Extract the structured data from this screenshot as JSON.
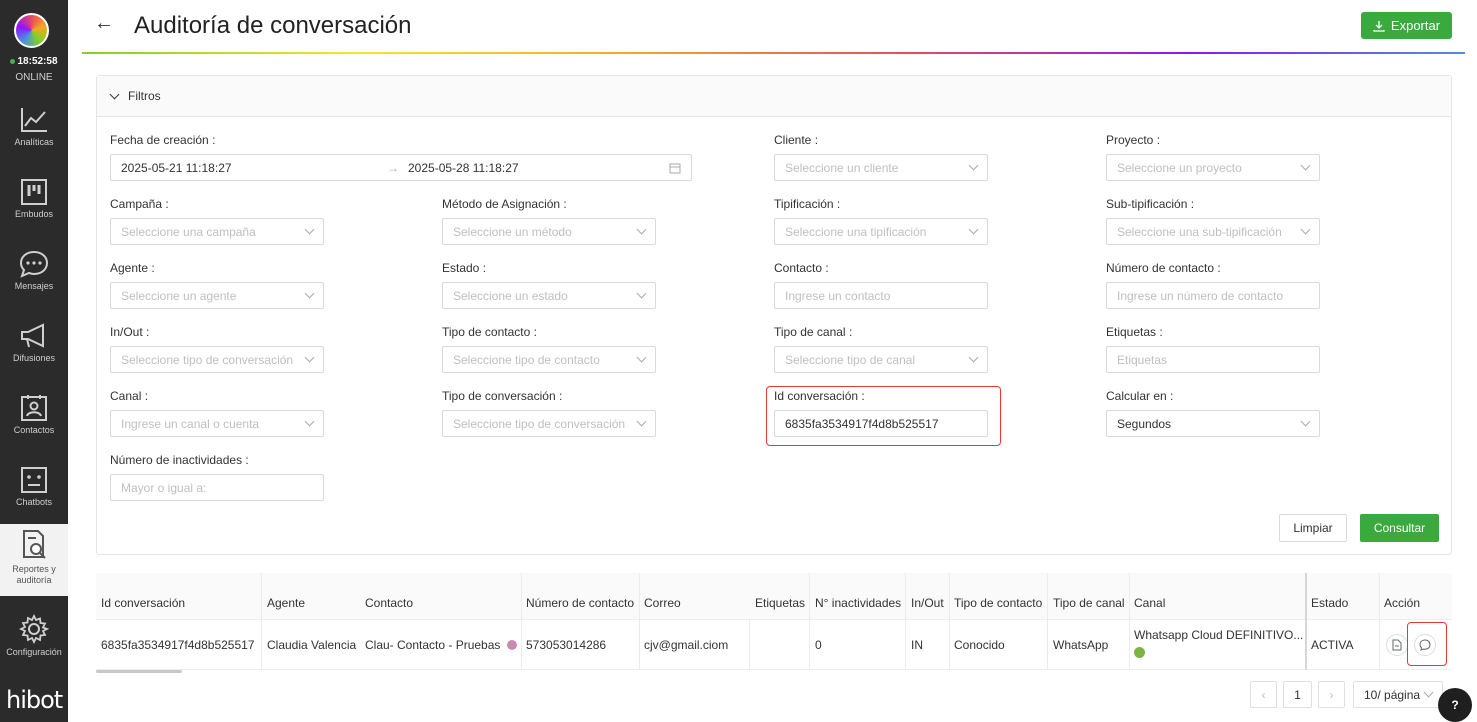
{
  "sidebar": {
    "time": "18:52:58",
    "status": "ONLINE",
    "items": [
      {
        "label": "Analíticas",
        "icon": "chart-line-icon"
      },
      {
        "label": "Embudos",
        "icon": "kanban-icon"
      },
      {
        "label": "Mensajes",
        "icon": "chat-bubble-icon"
      },
      {
        "label": "Difusiones",
        "icon": "megaphone-icon"
      },
      {
        "label": "Contactos",
        "icon": "contact-card-icon"
      },
      {
        "label": "Chatbots",
        "icon": "robot-icon"
      },
      {
        "label": "Reportes y auditoría",
        "icon": "report-search-icon"
      },
      {
        "label": "Configuración",
        "icon": "gear-icon"
      }
    ],
    "brand": "hibot"
  },
  "header": {
    "title": "Auditoría de conversación",
    "export_label": "Exportar"
  },
  "filters": {
    "section_label": "Filtros",
    "fecha_label": "Fecha de creación",
    "fecha_start": "2025-05-21 11:18:27",
    "fecha_end": "2025-05-28 11:18:27",
    "cliente_label": "Cliente",
    "cliente_ph": "Seleccione un cliente",
    "proyecto_label": "Proyecto",
    "proyecto_ph": "Seleccione un proyecto",
    "campana_label": "Campaña",
    "campana_ph": "Seleccione una campaña",
    "metodo_label": "Método de Asignación",
    "metodo_ph": "Seleccione un método",
    "tipificacion_label": "Tipificación",
    "tipificacion_ph": "Seleccione una tipificación",
    "subtip_label": "Sub-tipificación",
    "subtip_ph": "Seleccione una sub-tipificación",
    "agente_label": "Agente",
    "agente_ph": "Seleccione un agente",
    "estado_label": "Estado",
    "estado_ph": "Seleccione un estado",
    "contacto_label": "Contacto",
    "contacto_ph": "Ingrese un contacto",
    "numero_label": "Número de contacto",
    "numero_ph": "Ingrese un número de contacto",
    "inout_label": "In/Out",
    "inout_ph": "Seleccione tipo de conversación",
    "tipocontacto_label": "Tipo de contacto",
    "tipocontacto_ph": "Seleccione tipo de contacto",
    "tipocanal_label": "Tipo de canal",
    "tipocanal_ph": "Seleccione tipo de canal",
    "etiquetas_label": "Etiquetas",
    "etiquetas_ph": "Etiquetas",
    "canal_label": "Canal",
    "canal_ph": "Ingrese un canal o cuenta",
    "tipoconv_label": "Tipo de conversación",
    "tipoconv_ph": "Seleccione tipo de conversación",
    "idconv_label": "Id conversación",
    "idconv_value": "6835fa3534917f4d8b525517",
    "calcular_label": "Calcular en",
    "calcular_value": "Segundos",
    "inact_label": "Número de inactividades",
    "inact_ph": "Mayor o igual a:",
    "limpiar": "Limpiar",
    "consultar": "Consultar"
  },
  "table": {
    "headers": [
      "Id conversación",
      "Agente",
      "Contacto",
      "Número de contacto",
      "Correo",
      "Etiquetas",
      "N° inactividades",
      "In/Out",
      "Tipo de contacto",
      "Tipo de canal",
      "Canal",
      "Estado",
      "Acción"
    ],
    "row": {
      "id": "6835fa3534917f4d8b525517",
      "agente": "Claudia Valencia",
      "contacto": "Clau- Contacto - Pruebas",
      "numero": "573053014286",
      "correo": "cjv@gmail.ciom",
      "etiquetas": "",
      "inactividades": "0",
      "inout": "IN",
      "tipo_contacto": "Conocido",
      "tipo_canal": "WhatsApp",
      "canal": "Whatsapp Cloud DEFINITIVO...",
      "estado": "ACTIVA"
    }
  },
  "pagination": {
    "current": "1",
    "page_size": "10/ página"
  },
  "colors": {
    "accent": "#3aaa3e",
    "highlight": "#e53935",
    "sidebar": "#2b2b2b"
  }
}
